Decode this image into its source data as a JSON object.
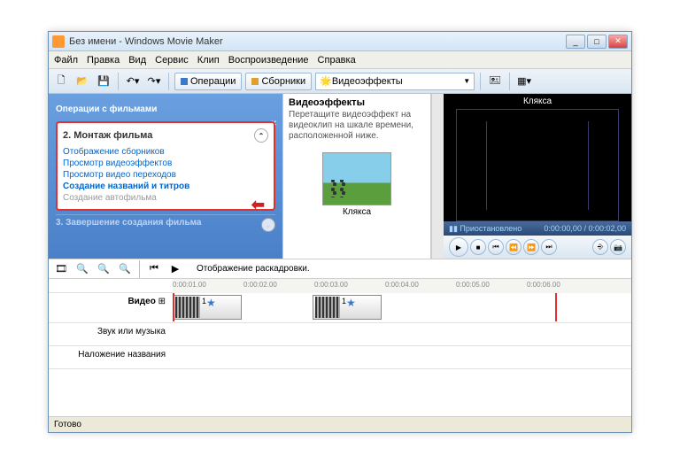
{
  "title": "Без имени - Windows Movie Maker",
  "menu": [
    "Файл",
    "Правка",
    "Вид",
    "Сервис",
    "Клип",
    "Воспроизведение",
    "Справка"
  ],
  "toolbar": {
    "ops": "Операции",
    "collections": "Сборники",
    "combo": "Видеоэффекты"
  },
  "tasks": {
    "header": "Операции с фильмами",
    "section_num": "2.",
    "section_title": "Монтаж фильма",
    "items": [
      "Отображение сборников",
      "Просмотр видеоэффектов",
      "Просмотр видео переходов",
      "Создание названий и титров",
      "Создание автофильма"
    ],
    "section3": "3. Завершение создания фильма"
  },
  "effects": {
    "title": "Видеоэффекты",
    "desc": "Перетащите видеоэффект на видеоклип на шкале времени, расположенной ниже.",
    "thumb_label": "Клякса"
  },
  "preview": {
    "title": "Клякса",
    "status": "Приостановлено",
    "time": "0:00:00,00 / 0:00:02,00"
  },
  "timeline": {
    "header": "Отображение раскадровки.",
    "marks": [
      "0:00:01.00",
      "0:00:02.00",
      "0:00:03.00",
      "0:00:04.00",
      "0:00:05.00",
      "0:00:06.00"
    ],
    "row_video": "Видео",
    "row_audio": "Звук или музыка",
    "row_overlay": "Наложение названия",
    "clip_label": "1"
  },
  "status": "Готово"
}
